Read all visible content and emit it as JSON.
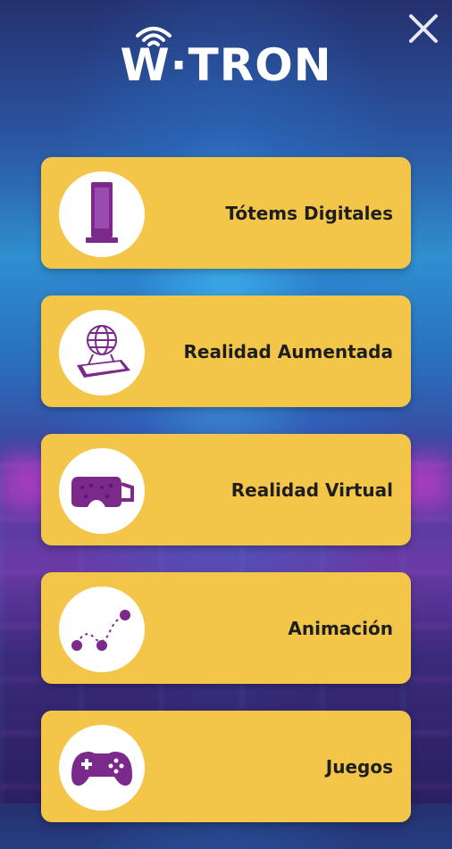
{
  "header": {
    "logo_text": "W·TRON",
    "close_icon": "close-icon"
  },
  "menu": {
    "items": [
      {
        "label": "Tótems Digitales",
        "icon": "totem-icon"
      },
      {
        "label": "Realidad Aumentada",
        "icon": "augmented-reality-icon"
      },
      {
        "label": "Realidad Virtual",
        "icon": "vr-headset-icon"
      },
      {
        "label": "Animación",
        "icon": "animation-path-icon"
      },
      {
        "label": "Juegos",
        "icon": "gamepad-icon"
      }
    ]
  },
  "colors": {
    "card": "#f3c64a",
    "icon_purple": "#7b2a8c",
    "text": "#1e1e1e"
  }
}
